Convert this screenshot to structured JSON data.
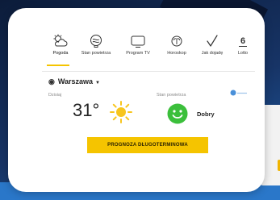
{
  "nav": {
    "items": [
      {
        "label": "Pogoda",
        "icon": "weather-icon",
        "active": true
      },
      {
        "label": "Stan powietrza",
        "icon": "air-quality-icon",
        "active": false
      },
      {
        "label": "Program TV",
        "icon": "tv-icon",
        "active": false
      },
      {
        "label": "Horoskop",
        "icon": "horoscope-icon",
        "active": false
      },
      {
        "label": "Jak dojadę",
        "icon": "route-icon",
        "active": false
      },
      {
        "label": "Lotto",
        "icon": "lotto-icon",
        "active": false
      }
    ],
    "lotto_glyph": "6"
  },
  "location": {
    "city": "Warszawa"
  },
  "weather": {
    "section_label": "Dzisiaj",
    "temperature": "31°",
    "condition_icon": "sun-icon"
  },
  "air": {
    "section_label": "Stan powietrza",
    "status": "Dobry",
    "status_icon": "smiley-icon"
  },
  "forecast_button": {
    "label": "PROGNOZA DŁUGOTERMINOWA"
  },
  "colors": {
    "accent": "#f5c400",
    "good_status": "#3bbf3b",
    "card": "#ffffff"
  }
}
